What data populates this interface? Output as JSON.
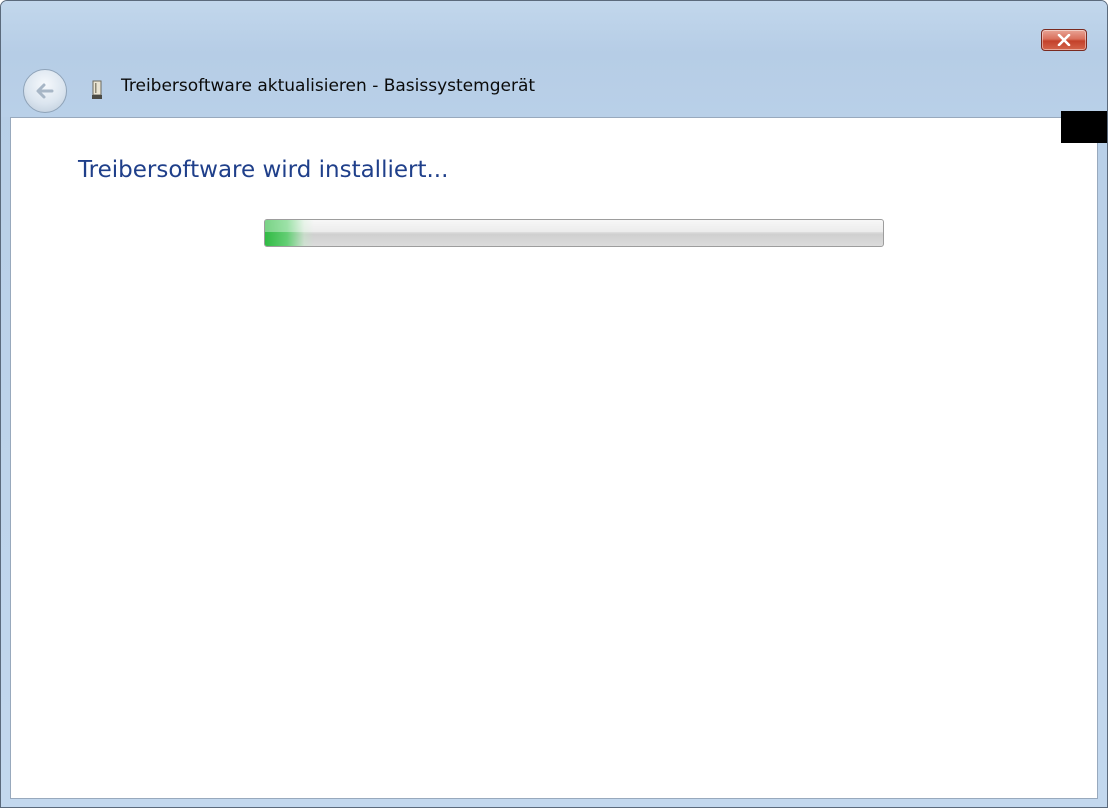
{
  "window": {
    "title": "Treibersoftware aktualisieren - Basissystemgerät",
    "close_icon": "close-x-icon",
    "back_icon": "back-arrow-icon",
    "device_icon": "device-icon"
  },
  "main": {
    "heading": "Treibersoftware wird installiert...",
    "progress": {
      "value_fraction": 0.08,
      "fill_color": "#2fbf4a"
    }
  },
  "colors": {
    "heading": "#1f3f8a",
    "titlebar": "#b9d0e8",
    "close_button": "#c3412a"
  }
}
